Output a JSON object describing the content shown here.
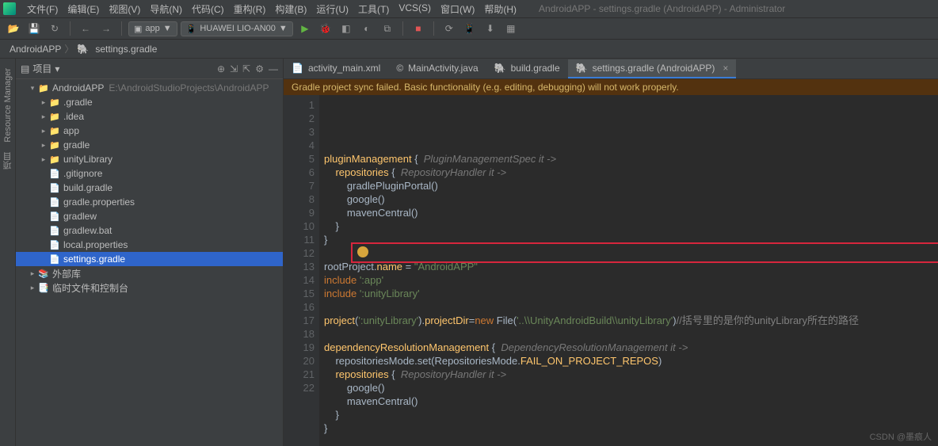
{
  "window_title": "AndroidAPP - settings.gradle (AndroidAPP) - Administrator",
  "menu": [
    "文件(F)",
    "编辑(E)",
    "视图(V)",
    "导航(N)",
    "代码(C)",
    "重构(R)",
    "构建(B)",
    "运行(U)",
    "工具(T)",
    "VCS(S)",
    "窗口(W)",
    "帮助(H)"
  ],
  "toolbar": {
    "config": "app",
    "device": "HUAWEI LIO-AN00",
    "arrow": "▼"
  },
  "breadcrumb": [
    "AndroidAPP",
    "settings.gradle"
  ],
  "left_rail": [
    "Resource Manager",
    "项目"
  ],
  "side_header": "项目",
  "tree": [
    {
      "depth": 0,
      "arrow": "▾",
      "icon": "📁",
      "label": "AndroidAPP",
      "dim": "E:\\AndroidStudioProjects\\AndroidAPP"
    },
    {
      "depth": 1,
      "arrow": "▸",
      "icon": "📁",
      "label": ".gradle",
      "cls": "folder-orange"
    },
    {
      "depth": 1,
      "arrow": "▸",
      "icon": "📁",
      "label": ".idea",
      "cls": "folder-orange"
    },
    {
      "depth": 1,
      "arrow": "▸",
      "icon": "📁",
      "label": "app"
    },
    {
      "depth": 1,
      "arrow": "▸",
      "icon": "📁",
      "label": "gradle"
    },
    {
      "depth": 1,
      "arrow": "▸",
      "icon": "📁",
      "label": "unityLibrary"
    },
    {
      "depth": 1,
      "arrow": "",
      "icon": "📄",
      "label": ".gitignore"
    },
    {
      "depth": 1,
      "arrow": "",
      "icon": "📄",
      "label": "build.gradle"
    },
    {
      "depth": 1,
      "arrow": "",
      "icon": "📄",
      "label": "gradle.properties"
    },
    {
      "depth": 1,
      "arrow": "",
      "icon": "📄",
      "label": "gradlew"
    },
    {
      "depth": 1,
      "arrow": "",
      "icon": "📄",
      "label": "gradlew.bat"
    },
    {
      "depth": 1,
      "arrow": "",
      "icon": "📄",
      "label": "local.properties"
    },
    {
      "depth": 1,
      "arrow": "",
      "icon": "📄",
      "label": "settings.gradle",
      "sel": true
    },
    {
      "depth": 0,
      "arrow": "▸",
      "icon": "📚",
      "label": "外部库"
    },
    {
      "depth": 0,
      "arrow": "▸",
      "icon": "📑",
      "label": "临时文件和控制台"
    }
  ],
  "tabs": [
    {
      "label": "activity_main.xml",
      "icon": "📄"
    },
    {
      "label": "MainActivity.java",
      "icon": "©"
    },
    {
      "label": "build.gradle",
      "icon": "🐘"
    },
    {
      "label": "settings.gradle (AndroidAPP)",
      "icon": "🐘",
      "active": true
    }
  ],
  "warning": "Gradle project sync failed. Basic functionality (e.g. editing, debugging) will not work properly.",
  "code_lines": [
    {
      "n": 1,
      "html": "<span class='fn'>pluginManagement</span> {  <span class='hint'>PluginManagementSpec it -&gt;</span>"
    },
    {
      "n": 2,
      "html": "    <span class='fn'>repositories</span> {  <span class='hint'>RepositoryHandler it -&gt;</span>"
    },
    {
      "n": 3,
      "html": "        gradlePluginPortal()"
    },
    {
      "n": 4,
      "html": "        google()"
    },
    {
      "n": 5,
      "html": "        mavenCentral()"
    },
    {
      "n": 6,
      "html": "    }"
    },
    {
      "n": 7,
      "html": "}"
    },
    {
      "n": 8,
      "html": ""
    },
    {
      "n": 9,
      "html": "rootProject.<span class='fn'>name</span> = <span class='str'>\"AndroidAPP\"</span>"
    },
    {
      "n": 10,
      "html": "<span class='kw'>include</span> <span class='str'>':app'</span>"
    },
    {
      "n": 11,
      "html": "<span class='kw'>include</span> <span class='str'>':unityLibrary'</span>"
    },
    {
      "n": 12,
      "html": ""
    },
    {
      "n": 13,
      "html": "<span class='fn'>project</span>(<span class='str'>':unityLibrary'</span>).<span class='fn'>projectDir</span>=<span class='kw'>new</span> File(<span class='str'>'..\\\\UnityAndroidBuild\\\\unityLibrary'</span>)<span class='cmt'>//括号里的是你的unityLibrary所在的路径</span>"
    },
    {
      "n": 14,
      "html": ""
    },
    {
      "n": 15,
      "html": "<span class='fn'>dependencyResolutionManagement</span> {  <span class='hint'>DependencyResolutionManagement it -&gt;</span>"
    },
    {
      "n": 16,
      "html": "    repositoriesMode.set(RepositoriesMode.<span class='fn'>FAIL_ON_PROJECT_REPOS</span>)"
    },
    {
      "n": 17,
      "html": "    <span class='fn'>repositories</span> {  <span class='hint'>RepositoryHandler it -&gt;</span>"
    },
    {
      "n": 18,
      "html": "        google()"
    },
    {
      "n": 19,
      "html": "        mavenCentral()"
    },
    {
      "n": 20,
      "html": "    }"
    },
    {
      "n": 21,
      "html": "}"
    },
    {
      "n": 22,
      "html": ""
    }
  ],
  "watermark": "CSDN @墨痕人"
}
